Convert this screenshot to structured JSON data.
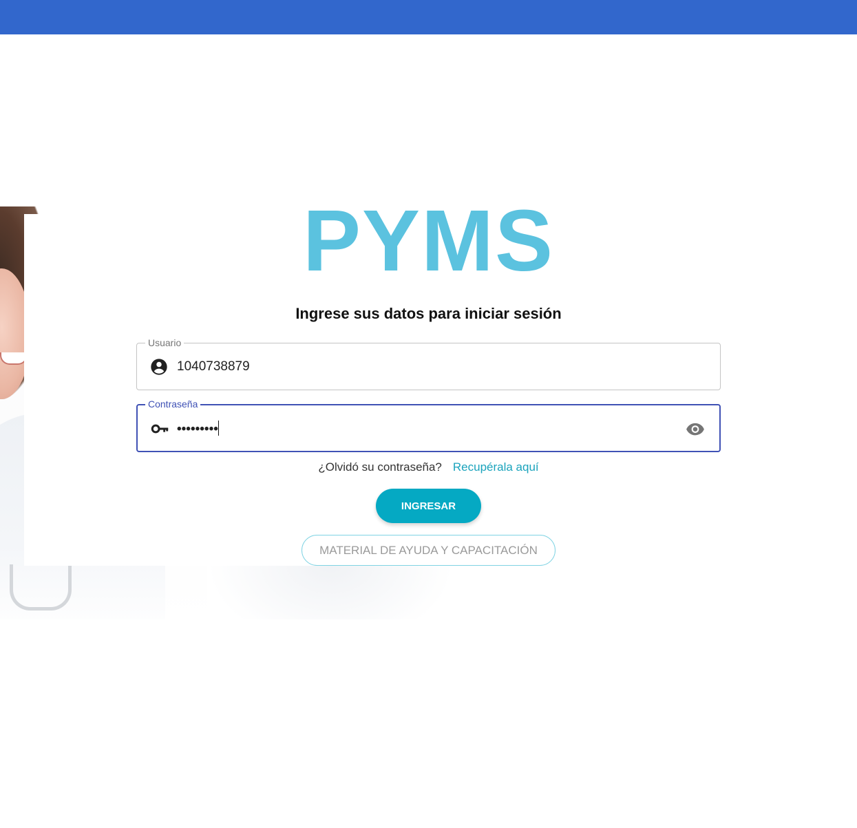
{
  "header": {
    "color": "#3267cc"
  },
  "brand": {
    "logo_text": "PYMS",
    "logo_color": "#5bc2df"
  },
  "login": {
    "subtitle": "Ingrese sus datos para iniciar sesión",
    "user_field": {
      "label": "Usuario",
      "value": "1040738879",
      "icon": "account-circle-icon"
    },
    "password_field": {
      "label": "Contraseña",
      "value": "•••••••••",
      "icon": "key-icon",
      "toggle_icon": "eye-icon"
    },
    "forgot_text": "¿Olvidó su contraseña?",
    "recover_link": "Recupérala aquí",
    "submit_label": "INGRESAR",
    "help_label": "MATERIAL DE AYUDA Y CAPACITACIÓN"
  },
  "colors": {
    "accent": "#05a9c3",
    "focus": "#3f51b5",
    "link": "#1aa3bc"
  }
}
